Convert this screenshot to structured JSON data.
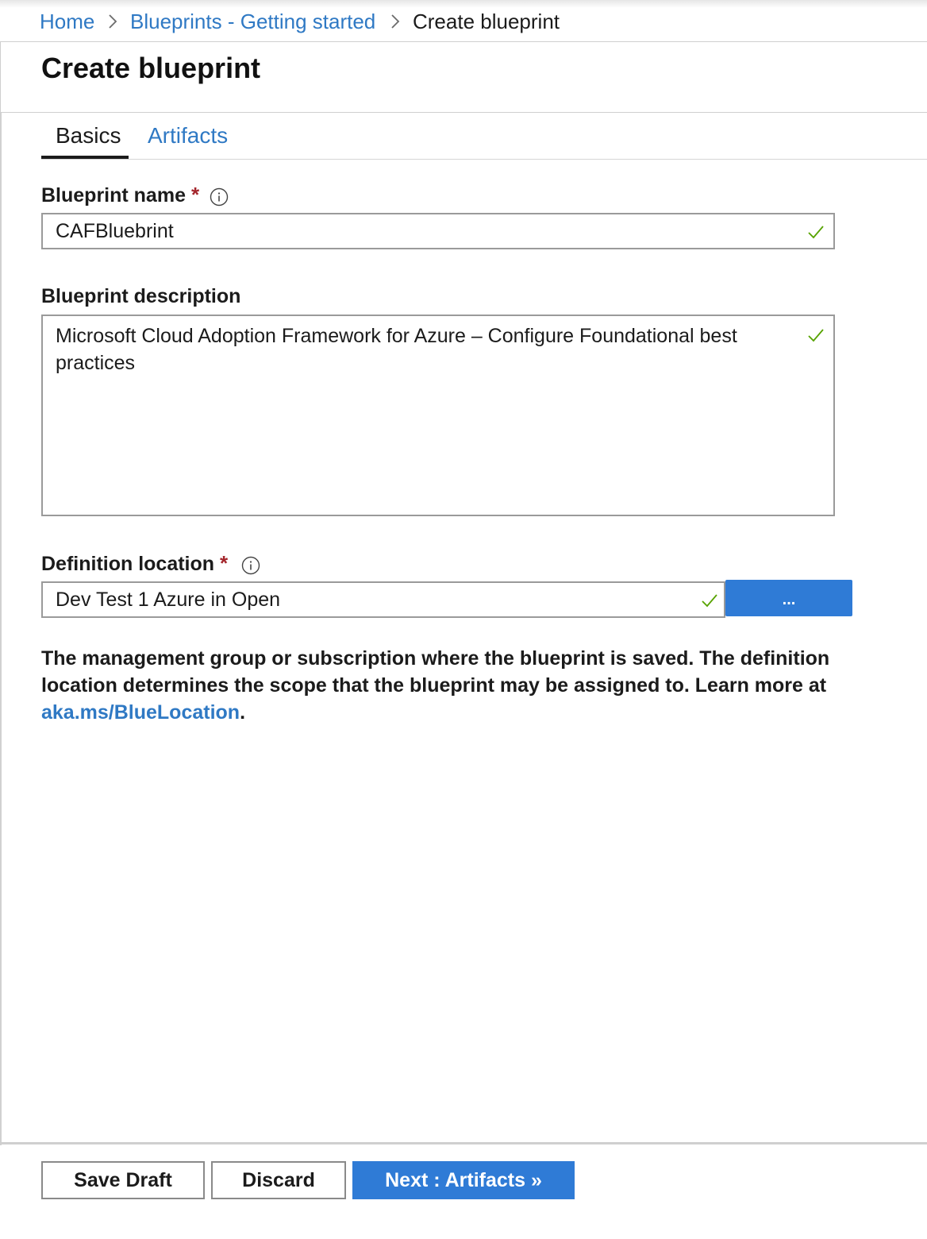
{
  "breadcrumb": {
    "items": [
      {
        "label": "Home"
      },
      {
        "label": "Blueprints - Getting started"
      },
      {
        "label": "Create blueprint"
      }
    ]
  },
  "page": {
    "title": "Create blueprint"
  },
  "tabs": [
    {
      "label": "Basics",
      "active": true
    },
    {
      "label": "Artifacts",
      "active": false
    }
  ],
  "form": {
    "name": {
      "label": "Blueprint name",
      "required_mark": "*",
      "value": "CAFBluebrint"
    },
    "description": {
      "label": "Blueprint description",
      "value": "Microsoft Cloud Adoption Framework for Azure – Configure Foundational best practices"
    },
    "location": {
      "label": "Definition location",
      "required_mark": "*",
      "value": "Dev Test 1 Azure in Open",
      "browse_label": "...",
      "help_text": "The management group or subscription where the blueprint is saved. The definition location determines the scope that the blueprint may be assigned to. Learn more at ",
      "help_link": "aka.ms/BlueLocation",
      "help_suffix": "."
    }
  },
  "footer": {
    "save_draft": "Save Draft",
    "discard": "Discard",
    "next": "Next : Artifacts »"
  },
  "colors": {
    "link": "#2f79c4",
    "primary": "#2f7bd6",
    "required": "#a4262c",
    "valid_check": "#57a300"
  },
  "icons": [
    "chevron-right-icon",
    "info-icon",
    "checkmark-icon"
  ]
}
